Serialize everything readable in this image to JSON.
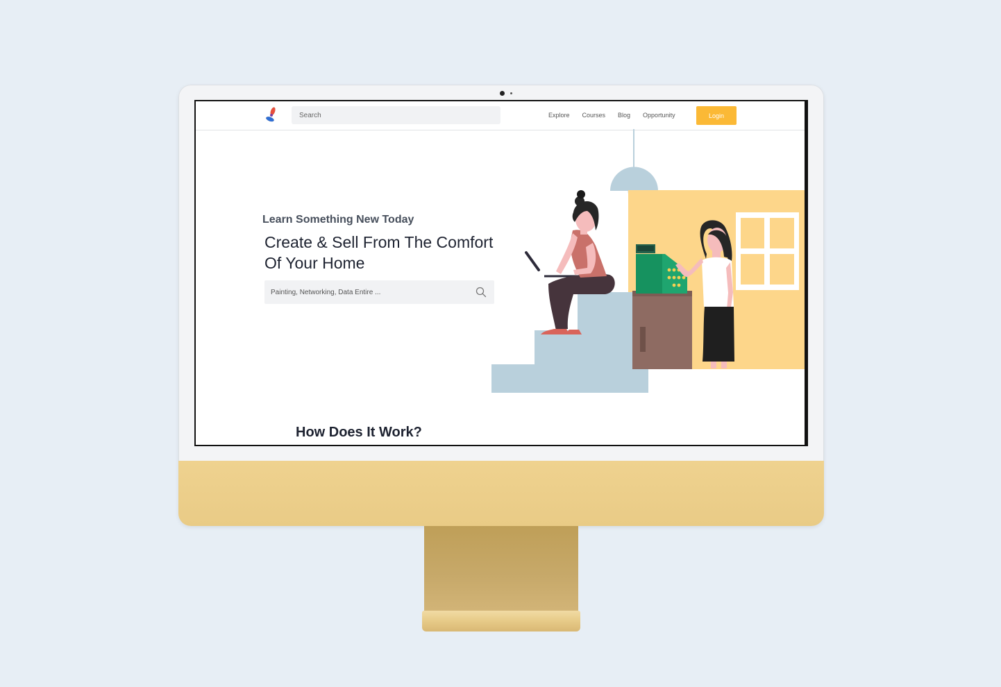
{
  "nav": {
    "search_placeholder": "Search",
    "links": [
      "Explore",
      "Courses",
      "Blog",
      "Opportunity"
    ],
    "login_label": "Login"
  },
  "hero": {
    "eyebrow": "Learn Something New Today",
    "title": "Create & Sell From The Comfort Of Your Home",
    "search_placeholder": "Painting, Networking, Data Entire ..."
  },
  "sections": {
    "how_title": "How Does It Work?"
  },
  "icons": {
    "logo": "pinwheel-logo-icon",
    "search": "search-icon",
    "illustration": "woman-laptop-cashier-illustration"
  },
  "colors": {
    "background": "#e7eef5",
    "accent": "#fbb936",
    "chin": "#ecce8a",
    "stand": "#c4a463",
    "illustration_wall": "#fdd68a",
    "illustration_steps": "#b9d0dc",
    "text_dark": "#1d2230"
  }
}
